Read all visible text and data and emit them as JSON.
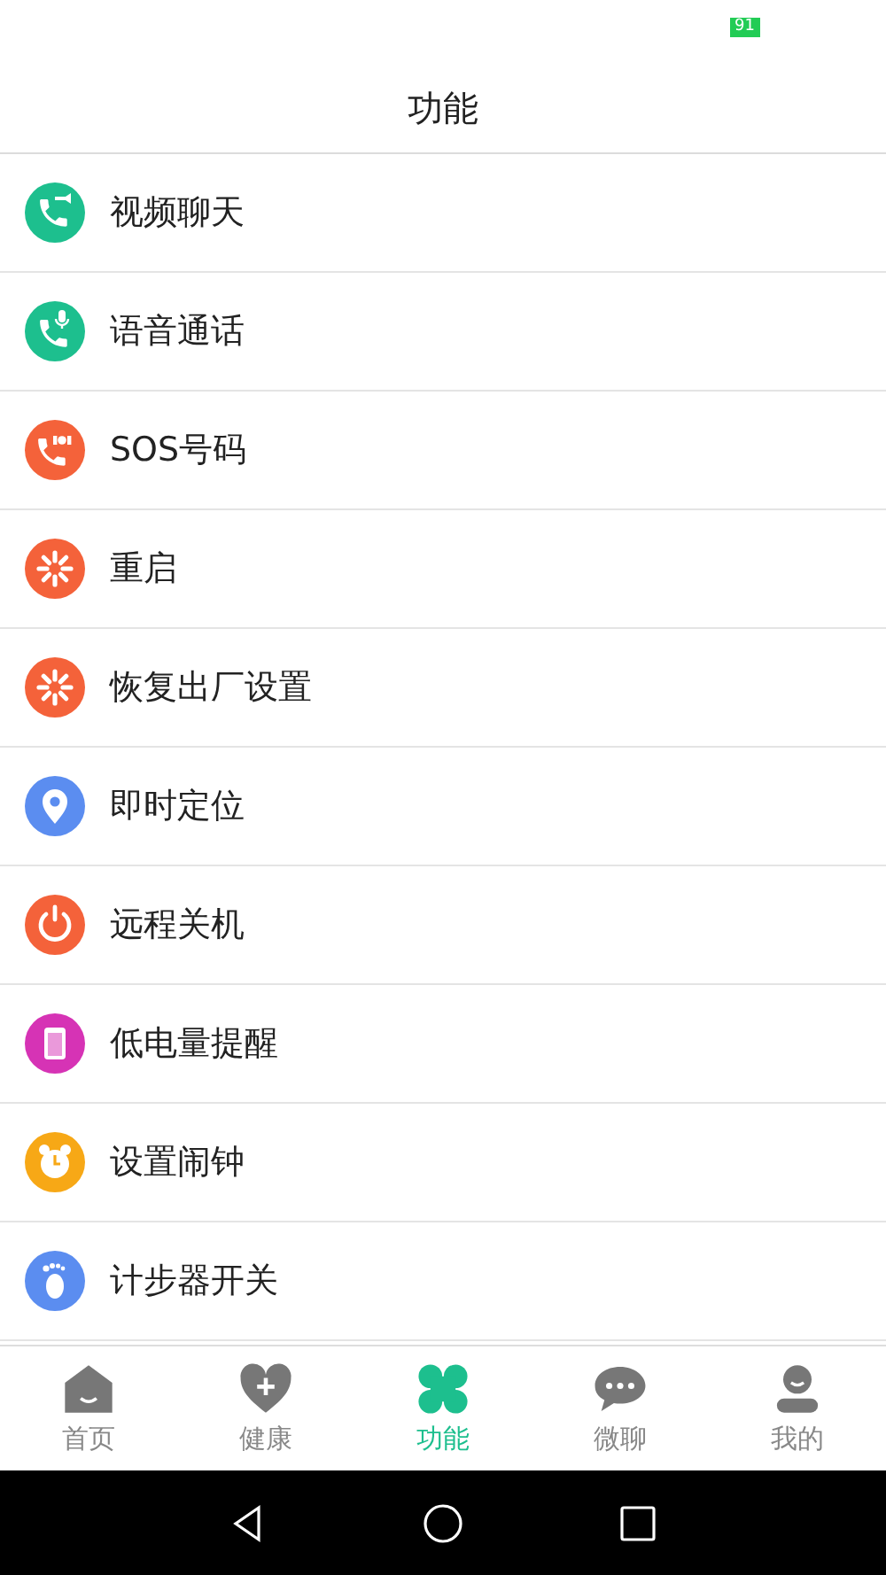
{
  "status_bar": {
    "battery": "91"
  },
  "header": {
    "title": "功能"
  },
  "items": [
    {
      "label": "视频聊天",
      "kind": "video-call",
      "color": "#1dbf8e"
    },
    {
      "label": "语音通话",
      "kind": "voice-call",
      "color": "#1dbf8e"
    },
    {
      "label": "SOS号码",
      "kind": "sos",
      "color": "#f4623a"
    },
    {
      "label": "重启",
      "kind": "restart",
      "color": "#f4623a"
    },
    {
      "label": "恢复出厂设置",
      "kind": "restart",
      "color": "#f4623a"
    },
    {
      "label": "即时定位",
      "kind": "location",
      "color": "#5b8df0"
    },
    {
      "label": "远程关机",
      "kind": "power",
      "color": "#f4623a"
    },
    {
      "label": "低电量提醒",
      "kind": "battery",
      "color": "#d633b5"
    },
    {
      "label": "设置闹钟",
      "kind": "alarm",
      "color": "#f7a816"
    },
    {
      "label": "计步器开关",
      "kind": "footprint",
      "color": "#5b8df0"
    }
  ],
  "tabs": [
    {
      "label": "首页",
      "kind": "home",
      "selected": false
    },
    {
      "label": "健康",
      "kind": "health",
      "selected": false
    },
    {
      "label": "功能",
      "kind": "function",
      "selected": true
    },
    {
      "label": "微聊",
      "kind": "chat",
      "selected": false
    },
    {
      "label": "我的",
      "kind": "me",
      "selected": false
    }
  ]
}
